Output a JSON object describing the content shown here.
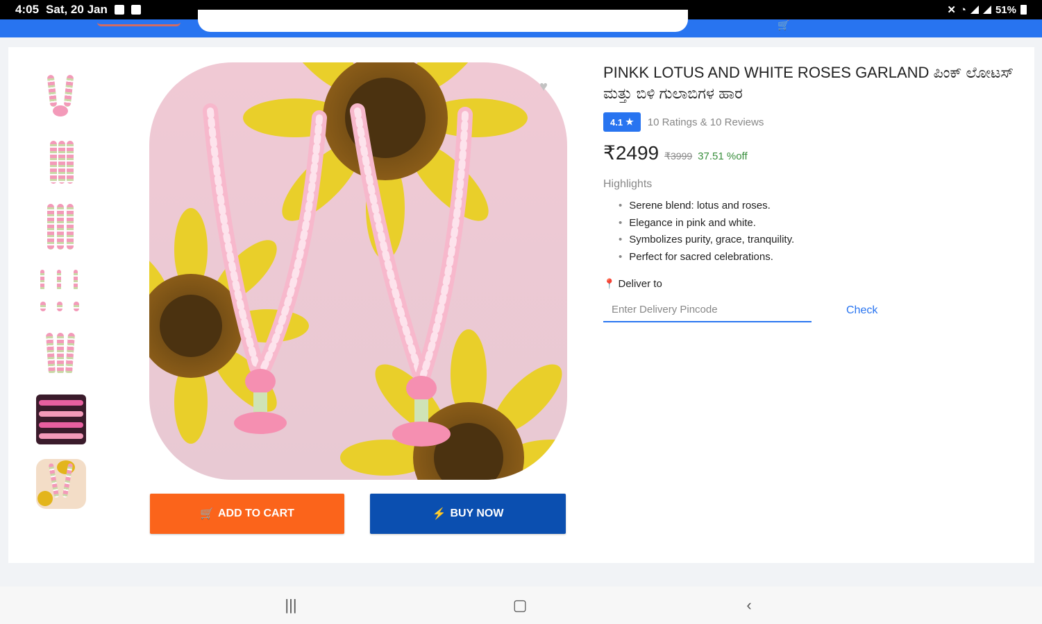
{
  "status_bar": {
    "time": "4:05",
    "date": "Sat, 20 Jan",
    "battery": "51%"
  },
  "product": {
    "title": "PINKK LOTUS AND WHITE ROSES GARLAND ಪಿಂಕ್ ಲೋಟಸ್ ಮತ್ತು ಬಿಳಿ ಗುಲಾಬಿಗಳ ಹಾರ",
    "rating": "4.1",
    "ratings_reviews": "10 Ratings & 10 Reviews",
    "price": "₹2499",
    "mrp": "₹3999",
    "discount": "37.51 %off",
    "highlights_label": "Highlights",
    "highlights": [
      "Serene blend: lotus and roses.",
      "Elegance in pink and white.",
      "Symbolizes purity, grace, tranquility.",
      "Perfect for sacred celebrations."
    ],
    "deliver_label": "Deliver to",
    "pincode_placeholder": "Enter Delivery Pincode",
    "check_label": "Check"
  },
  "actions": {
    "add_to_cart": "ADD TO CART",
    "buy_now": "BUY NOW"
  },
  "colors": {
    "brand_blue": "#2874f0",
    "cart_orange": "#fb641b",
    "buy_blue": "#0b4fb0",
    "discount_green": "#388e3c"
  },
  "icons": {
    "cart": "cart-icon",
    "buy": "lightning-icon",
    "wishlist": "heart-icon",
    "location": "location-pin-icon",
    "rating": "star-icon",
    "nav_recent": "recent-apps-icon",
    "nav_home": "home-icon",
    "nav_back": "back-icon"
  }
}
